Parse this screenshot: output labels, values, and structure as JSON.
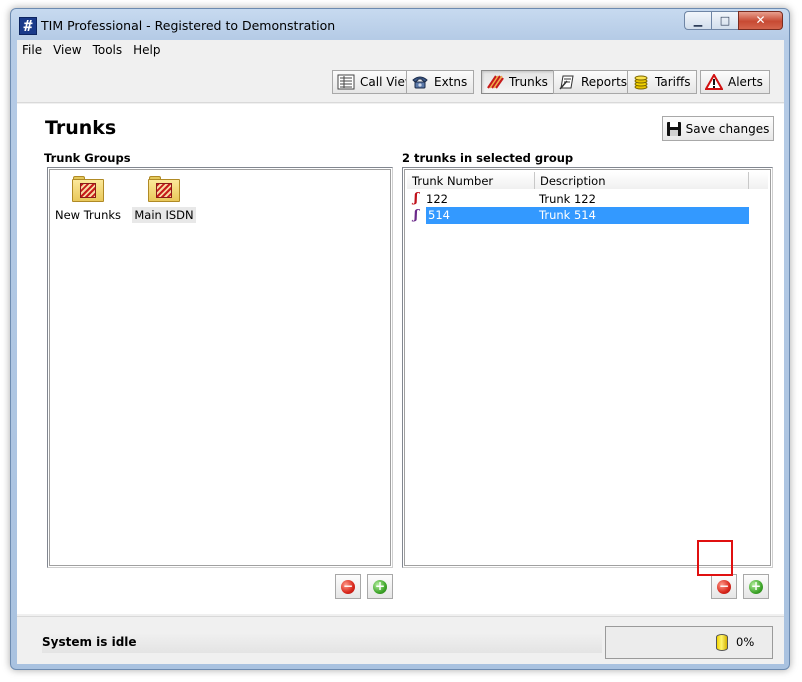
{
  "window": {
    "title": "TIM Professional - Registered to Demonstration",
    "app_icon_glyph": "#",
    "controls": {
      "minimize": "▁",
      "maximize": "□",
      "close": "✕"
    }
  },
  "menubar": {
    "items": [
      "File",
      "View",
      "Tools",
      "Help"
    ]
  },
  "toolbar": {
    "buttons": [
      {
        "label": "Call View",
        "icon": "call-view-icon"
      },
      {
        "label": "Extns",
        "icon": "phone-icon"
      },
      {
        "label": "Trunks",
        "icon": "trunks-icon",
        "active": true
      },
      {
        "label": "Reports",
        "icon": "reports-icon"
      },
      {
        "label": "Tariffs",
        "icon": "coins-icon"
      },
      {
        "label": "Alerts",
        "icon": "warning-icon"
      }
    ]
  },
  "page": {
    "title": "Trunks",
    "save_label": "Save changes"
  },
  "trunk_groups": {
    "heading": "Trunk Groups",
    "items": [
      {
        "label": "New Trunks",
        "selected": false
      },
      {
        "label": "Main ISDN",
        "selected": true
      }
    ]
  },
  "trunks": {
    "heading": "2 trunks in selected group",
    "columns": [
      "Trunk Number",
      "Description"
    ],
    "rows": [
      {
        "number": "122",
        "description": "Trunk 122",
        "selected": false
      },
      {
        "number": "514",
        "description": "Trunk 514",
        "selected": true
      }
    ]
  },
  "buttons": {
    "remove_symbol": "−",
    "add_symbol": "+"
  },
  "status": {
    "text": "System is idle",
    "progress": "0%"
  },
  "colors": {
    "selection": "#3399ff",
    "remove": "#d8261a",
    "add": "#3ea52a",
    "highlight": "#e01010"
  }
}
